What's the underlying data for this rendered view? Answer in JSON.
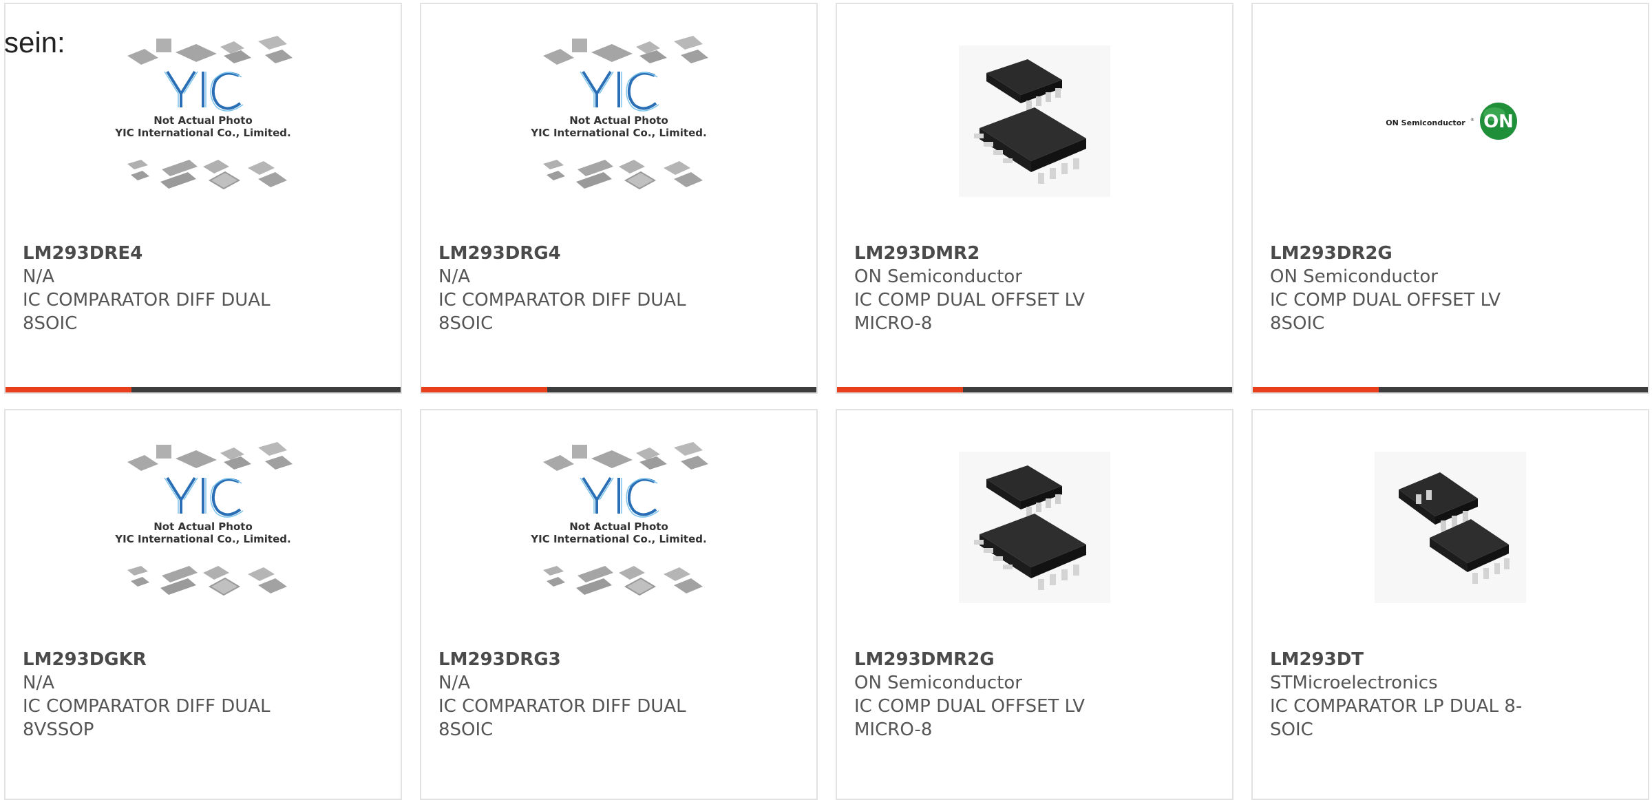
{
  "heading": "sein:",
  "accent_color": "#e8401c",
  "bar_color": "#3d3d3d",
  "placeholder": {
    "line1": "Not Actual Photo",
    "line2": "YIC International Co., Limited."
  },
  "brand_logo": {
    "text": "ON Semiconductor",
    "badge": "ON",
    "badge_color": "#1f8f3a"
  },
  "products": [
    {
      "part": "LM293DRE4",
      "manufacturer": "N/A",
      "desc1": "IC COMPARATOR DIFF DUAL",
      "desc2": "8SOIC",
      "image": "placeholder"
    },
    {
      "part": "LM293DRG4",
      "manufacturer": "N/A",
      "desc1": "IC COMPARATOR DIFF DUAL",
      "desc2": "8SOIC",
      "image": "placeholder"
    },
    {
      "part": "LM293DMR2",
      "manufacturer": "ON Semiconductor",
      "desc1": "IC COMP DUAL OFFSET LV",
      "desc2": "MICRO-8",
      "image": "chip"
    },
    {
      "part": "LM293DR2G",
      "manufacturer": "ON Semiconductor",
      "desc1": "IC COMP DUAL OFFSET LV 8SOIC",
      "desc2": "",
      "image": "logo"
    },
    {
      "part": "LM293DGKR",
      "manufacturer": "N/A",
      "desc1": "IC COMPARATOR DIFF DUAL",
      "desc2": "8VSSOP",
      "image": "placeholder"
    },
    {
      "part": "LM293DRG3",
      "manufacturer": "N/A",
      "desc1": "IC COMPARATOR DIFF DUAL",
      "desc2": "8SOIC",
      "image": "placeholder"
    },
    {
      "part": "LM293DMR2G",
      "manufacturer": "ON Semiconductor",
      "desc1": "IC COMP DUAL OFFSET LV",
      "desc2": "MICRO-8",
      "image": "chip"
    },
    {
      "part": "LM293DT",
      "manufacturer": "STMicroelectronics",
      "desc1": "IC COMPARATOR LP DUAL 8-",
      "desc2": "SOIC",
      "image": "chip-single"
    }
  ]
}
